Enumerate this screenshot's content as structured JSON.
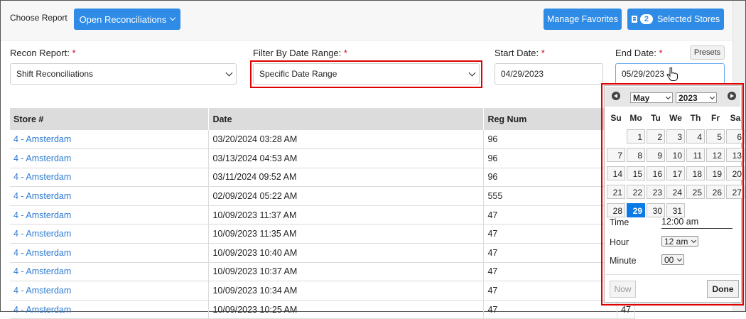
{
  "header": {
    "choose_report_label": "Choose Report",
    "open_button_label": "Open Reconciliations",
    "manage_favorites_label": "Manage Favorites",
    "selected_stores_count": "2",
    "selected_stores_label": "Selected Stores"
  },
  "filters": {
    "recon_report_label": "Recon Report:",
    "recon_report_value": "Shift Reconciliations",
    "filter_label": "Filter By Date Range:",
    "filter_value": "Specific Date Range",
    "start_label": "Start Date:",
    "start_value": "04/29/2023",
    "end_label": "End Date:",
    "end_value": "05/29/2023",
    "presets_label": "Presets",
    "required_mark": "*"
  },
  "table": {
    "headers": [
      "Store #",
      "Date",
      "Reg Num",
      ""
    ],
    "rows": [
      {
        "store": "4 - Amsterdam",
        "date": "03/20/2024 03:28 AM",
        "reg": "96",
        "extra": ""
      },
      {
        "store": "4 - Amsterdam",
        "date": "03/13/2024 04:53 AM",
        "reg": "96",
        "extra": ""
      },
      {
        "store": "4 - Amsterdam",
        "date": "03/11/2024 09:52 AM",
        "reg": "96",
        "extra": ""
      },
      {
        "store": "4 - Amsterdam",
        "date": "02/09/2024 05:22 AM",
        "reg": "555",
        "extra": ""
      },
      {
        "store": "4 - Amsterdam",
        "date": "10/09/2023 11:37 AM",
        "reg": "47",
        "extra": ""
      },
      {
        "store": "4 - Amsterdam",
        "date": "10/09/2023 11:35 AM",
        "reg": "47",
        "extra": ""
      },
      {
        "store": "4 - Amsterdam",
        "date": "10/09/2023 10:40 AM",
        "reg": "47",
        "extra": ""
      },
      {
        "store": "4 - Amsterdam",
        "date": "10/09/2023 10:37 AM",
        "reg": "47",
        "extra": ""
      },
      {
        "store": "4 - Amsterdam",
        "date": "10/09/2023 10:34 AM",
        "reg": "47",
        "extra": ""
      },
      {
        "store": "4 - Amsterdam",
        "date": "10/09/2023 10:25 AM",
        "reg": "47",
        "extra": "47"
      }
    ]
  },
  "datepicker": {
    "month": "May",
    "year": "2023",
    "weekdays": [
      "Su",
      "Mo",
      "Tu",
      "We",
      "Th",
      "Fr",
      "Sa"
    ],
    "first_weekday_index": 1,
    "days_in_month": 31,
    "selected_day": 29,
    "time_label": "Time",
    "time_value": "12:00 am",
    "hour_label": "Hour",
    "hour_value": "12 am",
    "minute_label": "Minute",
    "minute_value": "00",
    "now_label": "Now",
    "done_label": "Done"
  },
  "colors": {
    "primary": "#2e8be6",
    "link": "#2e7bd1",
    "highlight_border": "#e00000",
    "selected_day": "#0a7ae6"
  }
}
